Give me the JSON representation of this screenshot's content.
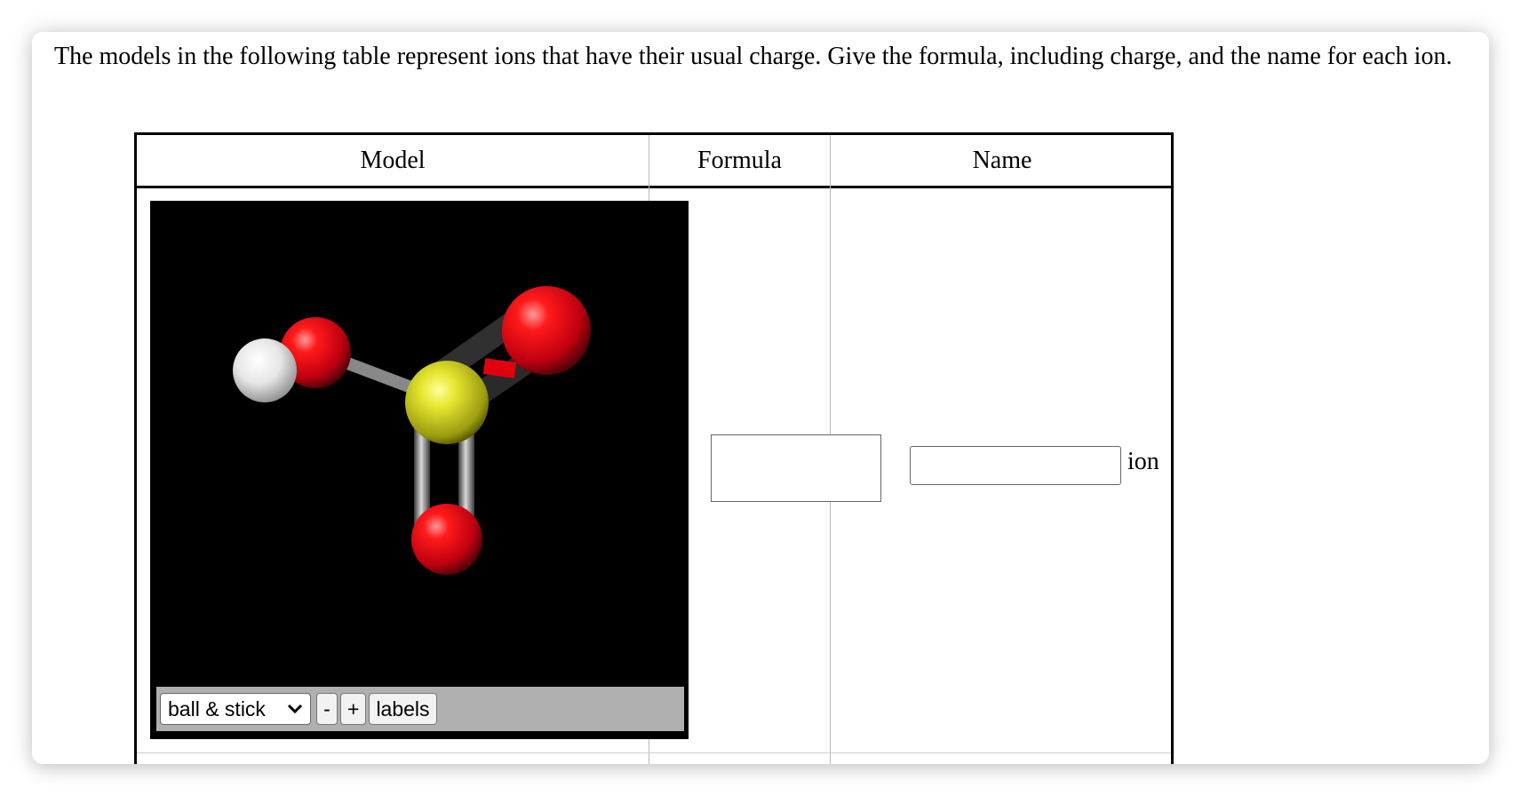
{
  "question": {
    "instructions": "The models in the following table represent ions that have their usual charge. Give the formula, including charge, and the name for each ion."
  },
  "table": {
    "headers": {
      "model": "Model",
      "formula": "Formula",
      "name": "Name"
    },
    "rows": [
      {
        "viewer": {
          "style_selected": "ball & stick",
          "zoom_out_label": "-",
          "zoom_in_label": "+",
          "labels_button": "labels"
        },
        "formula_value": "",
        "name_value": "",
        "name_suffix": "ion"
      }
    ]
  },
  "colors": {
    "oxygen": "#e8001a",
    "sulfur": "#d8d820",
    "hydrogen": "#ffffff",
    "viewer_background": "#000000",
    "controls_bar": "#b0b0b0"
  }
}
